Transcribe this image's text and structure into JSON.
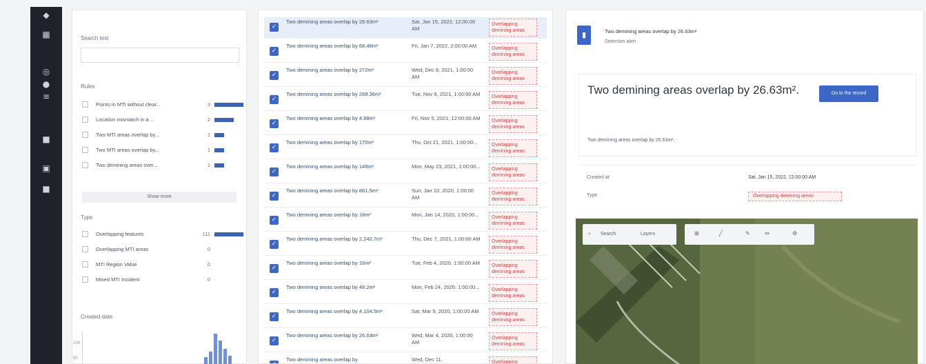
{
  "rail": {
    "icons": [
      "logo-icon",
      "layers-icon",
      "globe-icon",
      "alert-icon",
      "list-icon",
      "settings-icon",
      "grid-icon",
      "user-icon"
    ]
  },
  "filters": {
    "search_label": "Search text",
    "search_placeholder": "",
    "rules_label": "Rules",
    "rules": [
      {
        "label": "Points in MTI without clear...",
        "count": "3"
      },
      {
        "label": "Location mismatch in a ...",
        "count": "2"
      },
      {
        "label": "Two MTI areas overlap by...",
        "count": "1"
      },
      {
        "label": "Two MTI areas overlap by...",
        "count": "1"
      },
      {
        "label": "Two demining areas over...",
        "count": "1"
      }
    ],
    "show_more": "Show more",
    "type_label": "Type",
    "types": [
      {
        "label": "Overlapping features",
        "count": "111"
      },
      {
        "label": "Overlapping MTI areas",
        "count": "0"
      },
      {
        "label": "MTI Region Value",
        "count": "0"
      },
      {
        "label": "Mixed MTI Incident",
        "count": "0"
      }
    ],
    "created_label": "Created date",
    "hist_ticks": [
      "100",
      "50"
    ]
  },
  "list": {
    "items": [
      {
        "title": "Two demining areas overlap by 28.63m²",
        "date": "Sat, Jan 15, 2022, 12:00:00 AM",
        "tag": "Overlapping demining areas"
      },
      {
        "title": "Two demining areas overlap by 68.46m²",
        "date": "Fri, Jan 7, 2022, 2:00:00 AM",
        "tag": "Overlapping demining areas"
      },
      {
        "title": "Two demining areas overlap by 272m²",
        "date": "Wed, Dec 8, 2021, 1:00:00 AM",
        "tag": "Overlapping demining areas"
      },
      {
        "title": "Two demining areas overlap by 268.36m²",
        "date": "Tue, Nov 9, 2021, 1:00:00 AM",
        "tag": "Overlapping demining areas"
      },
      {
        "title": "Two demining areas overlap by 4.88m²",
        "date": "Fri, Nov 5, 2021, 12:00:00 AM",
        "tag": "Overlapping demining areas"
      },
      {
        "title": "Two demining areas overlap by 170m²",
        "date": "Thu, Oct 21, 2021, 1:00:00...",
        "tag": "Overlapping demining areas"
      },
      {
        "title": "Two demining areas overlap by 148m²",
        "date": "Mon, May 23, 2021, 1:00:00...",
        "tag": "Overlapping demining areas"
      },
      {
        "title": "Two demining areas overlap by 861.5m²",
        "date": "Sun, Jan 10, 2020, 1:00:00 AM",
        "tag": "Overlapping demining areas"
      },
      {
        "title": "Two demining areas overlap by 18m²",
        "date": "Mon, Jan 14, 2020, 1:00:00...",
        "tag": "Overlapping demining areas"
      },
      {
        "title": "Two demining areas overlap by 2,242.7m²",
        "date": "Thu, Dec 7, 2021, 1:00:00 AM",
        "tag": "Overlapping demining areas"
      },
      {
        "title": "Two demining areas overlap by 16m²",
        "date": "Tue, Feb 4, 2020, 1:00:00 AM",
        "tag": "Overlapping demining areas"
      },
      {
        "title": "Two demining areas overlap by 48.2m²",
        "date": "Mon, Feb 24, 2020, 1:00:00...",
        "tag": "Overlapping demining areas"
      },
      {
        "title": "Two demining areas overlap by 4,104.5m²",
        "date": "Sat, Mar 9, 2020, 1:00:00 AM",
        "tag": "Overlapping demining areas"
      },
      {
        "title": "Two demining areas overlap by 26.63m²",
        "date": "Wed, Mar 4, 2020, 1:00:00 AM",
        "tag": "Overlapping demining areas"
      },
      {
        "title": "Two demining areas overlap by",
        "date": "Wed, Dec 11,",
        "tag": "Overlapping"
      }
    ]
  },
  "detail": {
    "header_title": "Two demining areas overlap by 26.63m²",
    "header_sub": "Detection alert",
    "big_title": "Two demining areas overlap by 26.63m².",
    "action_label": "Go to the record",
    "description": "Two demining areas overlap by 26.63m².",
    "meta": [
      {
        "key": "Created at",
        "value": "Sat, Jan 15, 2022, 12:00:00 AM"
      },
      {
        "key": "Type",
        "value": ""
      }
    ],
    "type_pill": "Overlapping demining areas",
    "map_search": "Search",
    "map_layers": "Layers"
  }
}
